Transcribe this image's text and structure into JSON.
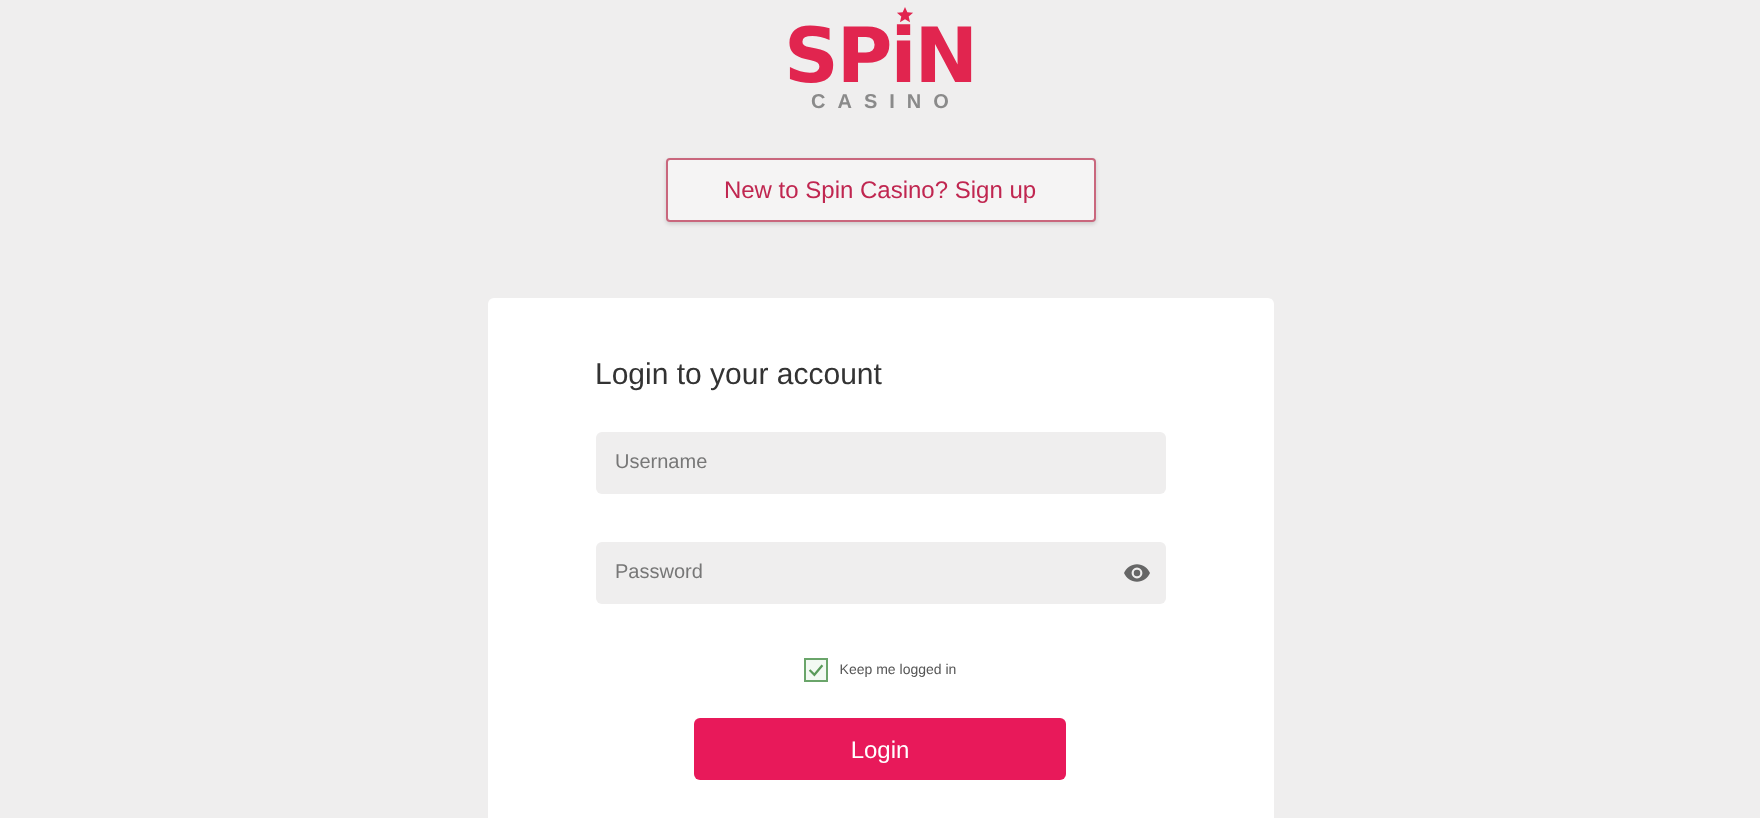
{
  "logo": {
    "word": "SPiN",
    "subword": "CASINO"
  },
  "signup_button": {
    "label": "New to Spin Casino? Sign up"
  },
  "login_card": {
    "title": "Login to your account",
    "fields": [
      {
        "kind": "text",
        "placeholder": "Username"
      },
      {
        "kind": "password",
        "placeholder": "Password"
      }
    ],
    "keep_logged_in": {
      "label": "Keep me logged in",
      "checked": true
    },
    "login_button": {
      "label": "Login"
    }
  }
}
